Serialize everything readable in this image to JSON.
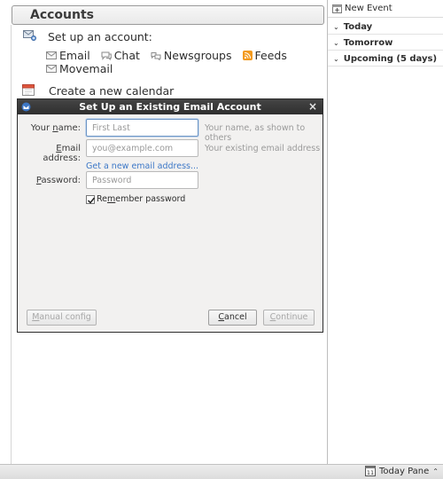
{
  "accounts": {
    "header": "Accounts",
    "setup_label": "Set up an account:",
    "types": [
      {
        "label": "Email",
        "icon": "envelope-icon"
      },
      {
        "label": "Chat",
        "icon": "chat-bubble-icon"
      },
      {
        "label": "Newsgroups",
        "icon": "newsgroup-icon"
      },
      {
        "label": "Feeds",
        "icon": "rss-feed-icon"
      },
      {
        "label": "Movemail",
        "icon": "envelope-icon"
      }
    ],
    "calendar_label": "Create a new calendar"
  },
  "dialog": {
    "title": "Set Up an Existing Email Account",
    "close_glyph": "×",
    "name": {
      "label_pre": "Your ",
      "label_key": "n",
      "label_post": "ame:",
      "placeholder": "First Last",
      "hint": "Your name, as shown to others"
    },
    "email": {
      "label_key": "E",
      "label_post": "mail address:",
      "placeholder": "you@example.com",
      "hint": "Your existing email address"
    },
    "get_new_link": "Get a new email address...",
    "password": {
      "label_key": "P",
      "label_post": "assword:",
      "placeholder": "Password"
    },
    "remember": {
      "pre": "Re",
      "key": "m",
      "post": "ember password",
      "checked": true
    },
    "buttons": {
      "manual_pre": "",
      "manual_key": "M",
      "manual_post": "anual config",
      "cancel_key": "C",
      "cancel_post": "ancel",
      "continue_key": "C",
      "continue_post": "ontinue"
    }
  },
  "today_pane": {
    "new_event": "New Event",
    "sections": [
      {
        "label": "Today",
        "expanded": true
      },
      {
        "label": "Tomorrow",
        "expanded": true
      },
      {
        "label": "Upcoming (5 days)",
        "expanded": true
      }
    ]
  },
  "status_bar": {
    "today_pane_label": "Today Pane",
    "calendar_icon_day": "11"
  },
  "colors": {
    "titlebar": "#3a3a3a",
    "link": "#3d78c7",
    "feed_orange": "#f39a1e",
    "dialog_bg": "#f2f1f0"
  }
}
